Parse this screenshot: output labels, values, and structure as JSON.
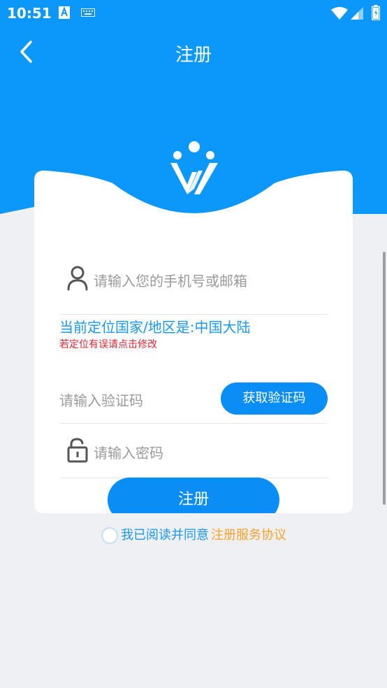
{
  "status_bar": {
    "time": "10:51"
  },
  "nav": {
    "title": "注册",
    "back_icon": "chevron-left-icon"
  },
  "form": {
    "account_placeholder": "请输入您的手机号或邮箱",
    "location_text": "当前定位国家/地区是:中国大陆",
    "location_hint": "若定位有误请点击修改",
    "code_placeholder": "请输入验证码",
    "get_code_label": "获取验证码",
    "password_placeholder": "请输入密码",
    "register_label": "注册"
  },
  "agreement": {
    "prefix": "我已阅读并同意",
    "link": "注册服务协议"
  },
  "colors": {
    "primary": "#0a8ef5",
    "header_blue": "#0c97fb",
    "link_orange": "#f7a22c",
    "hint_red": "#e0242f",
    "background": "#eff0f4"
  }
}
